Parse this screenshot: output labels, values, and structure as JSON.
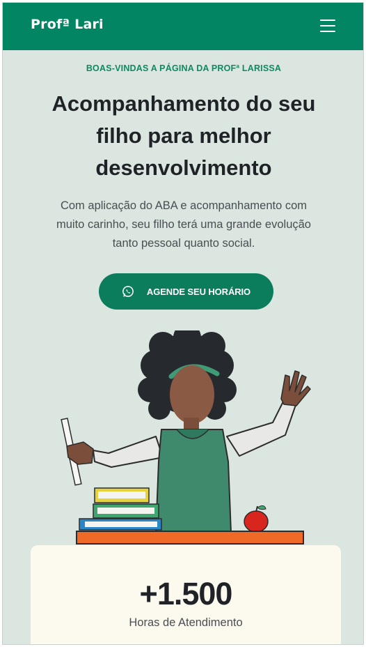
{
  "header": {
    "logo": "Profª Lari",
    "menu_icon": "hamburger-menu-icon"
  },
  "hero": {
    "eyebrow": "BOAS-VINDAS A PÁGINA DA PROFª LARISSA",
    "headline_line1": "Acompanhamento do seu",
    "headline_line2": "filho para melhor",
    "headline_line3": "desenvolvimento",
    "subtitle_line1": "Com aplicação do ABA e acompanhamento com",
    "subtitle_line2": "muito carinho, seu filho terá uma grande evolução",
    "subtitle_line3": "tanto pessoal quanto social.",
    "cta_label": "AGENDE SEU HORÁRIO",
    "cta_icon": "whatsapp-icon"
  },
  "stats": {
    "value": "+1.500",
    "label": "Horas de Atendimento"
  },
  "colors": {
    "brand_green": "#018562",
    "background": "#dbe6e0",
    "card_bg": "#fcf9ef",
    "text_dark": "#1f2226"
  }
}
